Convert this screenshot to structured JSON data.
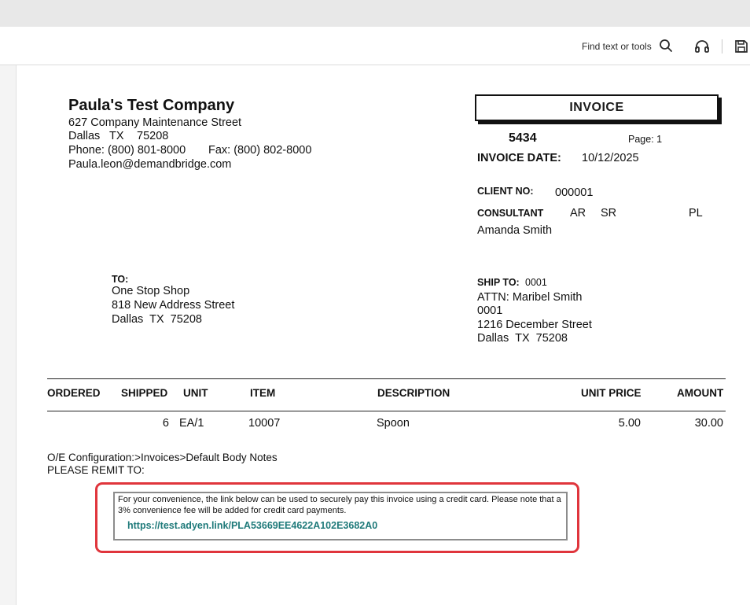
{
  "toolbar": {
    "find_label": "Find text or tools"
  },
  "company": {
    "name": "Paula's Test Company",
    "address1": "627 Company Maintenance Street",
    "city": "Dallas",
    "state": "TX",
    "zip": "75208",
    "phone": "Phone: (800) 801-8000",
    "fax": "Fax: (800) 802-8000",
    "email": "Paula.leon@demandbridge.com"
  },
  "invoice": {
    "title": "INVOICE",
    "number": "5434",
    "page": "Page: 1",
    "date_label": "INVOICE DATE:",
    "date": "10/12/2025",
    "client_label": "CLIENT NO:",
    "client_no": "000001",
    "consultant_label": "CONSULTANT",
    "ar": "AR",
    "sr": "SR",
    "pl": "PL",
    "consultant_name": "Amanda Smith"
  },
  "bill_to": {
    "label": "TO:",
    "name": "One Stop Shop",
    "street": "818 New Address Street",
    "city_line": "Dallas  TX  75208"
  },
  "ship_to": {
    "label": "SHIP TO:",
    "code": "0001",
    "attn": "ATTN: Maribel Smith",
    "id": "0001",
    "street": "1216 December Street",
    "city_line": "Dallas  TX  75208"
  },
  "table": {
    "headers": [
      "ORDERED",
      "SHIPPED",
      "UNIT",
      "ITEM",
      "DESCRIPTION",
      "UNIT PRICE",
      "AMOUNT"
    ],
    "rows": [
      {
        "ordered": "",
        "shipped": "6",
        "unit": "EA/1",
        "item": "10007",
        "description": "Spoon",
        "unit_price": "5.00",
        "amount": "30.00"
      }
    ]
  },
  "notes": {
    "config": "O/E Configuration:>Invoices>Default Body Notes",
    "remit": "PLEASE REMIT TO:",
    "payment_text": "For your convenience, the link below can be used to securely pay this invoice using a credit card.  Please note that a 3% convenience fee will be added for credit card payments.",
    "payment_link": "https://test.adyen.link/PLA53669EE4622A102E3682A0"
  }
}
